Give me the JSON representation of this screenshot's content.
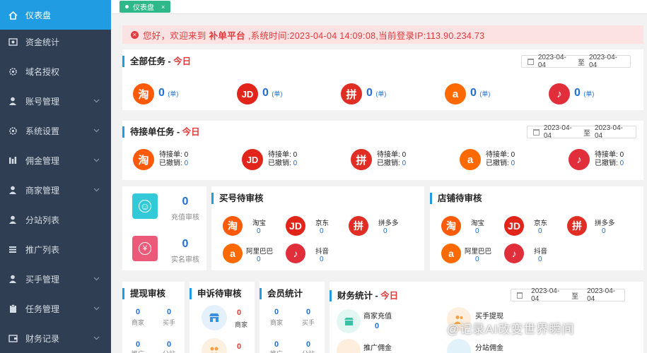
{
  "sidebar": {
    "items": [
      {
        "label": "仪表盘",
        "icon": "dashboard-icon"
      },
      {
        "label": "资金统计",
        "icon": "money-icon"
      },
      {
        "label": "域名授权",
        "icon": "gear-icon"
      },
      {
        "label": "账号管理",
        "icon": "user-icon"
      },
      {
        "label": "系统设置",
        "icon": "gear-icon"
      },
      {
        "label": "佣金管理",
        "icon": "chart-icon"
      },
      {
        "label": "商家管理",
        "icon": "user-icon"
      },
      {
        "label": "分站列表",
        "icon": "user-icon"
      },
      {
        "label": "推广列表",
        "icon": "list-icon"
      },
      {
        "label": "买手管理",
        "icon": "user-icon"
      },
      {
        "label": "任务管理",
        "icon": "clipboard-icon"
      },
      {
        "label": "财务记录",
        "icon": "wallet-icon"
      }
    ]
  },
  "tab": {
    "label": "仪表盘",
    "close": "×"
  },
  "alert": {
    "prefix": "您好，欢迎来到",
    "platform": "补单平台",
    "rest": ",系统时间:2023-04-04 14:09:08,当前登录IP:113.90.234.73"
  },
  "all_tasks": {
    "title": "全部任务",
    "sep": " - ",
    "today": "今日",
    "date_from": "2023-04-04",
    "date_sep": "至",
    "date_to": "2023-04-04",
    "unit": "(单)",
    "items": [
      {
        "logo": "淘",
        "value": "0"
      },
      {
        "logo": "JD",
        "value": "0"
      },
      {
        "logo": "拼",
        "value": "0"
      },
      {
        "logo": "a",
        "value": "0"
      },
      {
        "logo": "♪",
        "value": "0"
      }
    ]
  },
  "pending_tasks": {
    "title": "待接单任务",
    "sep": " - ",
    "today": "今日",
    "date_from": "2023-04-04",
    "date_sep": "至",
    "date_to": "2023-04-04",
    "label_pending": "待接单:",
    "label_cancelled": "已撤销:",
    "items": [
      {
        "logo": "淘",
        "pending": "0",
        "cancelled": "0"
      },
      {
        "logo": "JD",
        "pending": "0",
        "cancelled": "0"
      },
      {
        "logo": "拼",
        "pending": "0",
        "cancelled": "0"
      },
      {
        "logo": "a",
        "pending": "0",
        "cancelled": "0"
      },
      {
        "logo": "♪",
        "pending": "0",
        "cancelled": "0"
      }
    ]
  },
  "review_left": {
    "recharge_value": "0",
    "recharge_label": "充值审核",
    "realname_value": "0",
    "realname_label": "实名审核",
    "recharge_glyph": "☺",
    "realname_glyph": "¥"
  },
  "buyer_review": {
    "title": "买号待审核",
    "items": [
      {
        "logo": "淘",
        "name": "淘宝",
        "value": "0"
      },
      {
        "logo": "JD",
        "name": "京东",
        "value": "0"
      },
      {
        "logo": "拼",
        "name": "拼多多",
        "value": "0"
      },
      {
        "logo": "a",
        "name": "阿里巴巴",
        "value": "0"
      },
      {
        "logo": "♪",
        "name": "抖音",
        "value": "0"
      }
    ]
  },
  "shop_review": {
    "title": "店铺待审核",
    "items": [
      {
        "logo": "淘",
        "name": "淘宝",
        "value": "0"
      },
      {
        "logo": "JD",
        "name": "京东",
        "value": "0"
      },
      {
        "logo": "拼",
        "name": "拼多多",
        "value": "0"
      },
      {
        "logo": "a",
        "name": "阿里巴巴",
        "value": "0"
      },
      {
        "logo": "♪",
        "name": "抖音",
        "value": "0"
      }
    ]
  },
  "withdraw_review": {
    "title": "提现审核",
    "merchant_value": "0",
    "merchant_label": "商家",
    "buyer_value": "0",
    "buyer_label": "买手",
    "row2_left_value": "0",
    "row2_left_label": "推广",
    "row2_right_value": "0",
    "row2_right_label": "分站"
  },
  "complaint_review": {
    "title": "申诉待审核",
    "value": "0",
    "label": "商家",
    "value2": "0"
  },
  "member_stats": {
    "title": "会员统计",
    "merchant_value": "0",
    "merchant_label": "商家",
    "buyer_value": "0",
    "buyer_label": "买手",
    "row2_left_value": "0",
    "row2_left_label": "推广",
    "row2_right_value": "0",
    "row2_right_label": "分站"
  },
  "finance": {
    "title": "财务统计",
    "sep": " - ",
    "today": "今日",
    "date_from": "2023-04-04",
    "date_sep": "至",
    "date_to": "2023-04-04",
    "merchant_recharge_label": "商家充值",
    "merchant_recharge_value": "0",
    "buyer_withdraw_label": "买手提现",
    "promo_commission_label": "推广佣金",
    "branch_commission_label": "分站佣金"
  },
  "watermark": "@记录AI改变世界瞬间",
  "colors": {
    "sidebar": "#2f3e52",
    "active": "#1f9ce2",
    "accent_red": "#e23a3a",
    "value_blue": "#1f6fd6",
    "tab_green": "#2fb889"
  }
}
